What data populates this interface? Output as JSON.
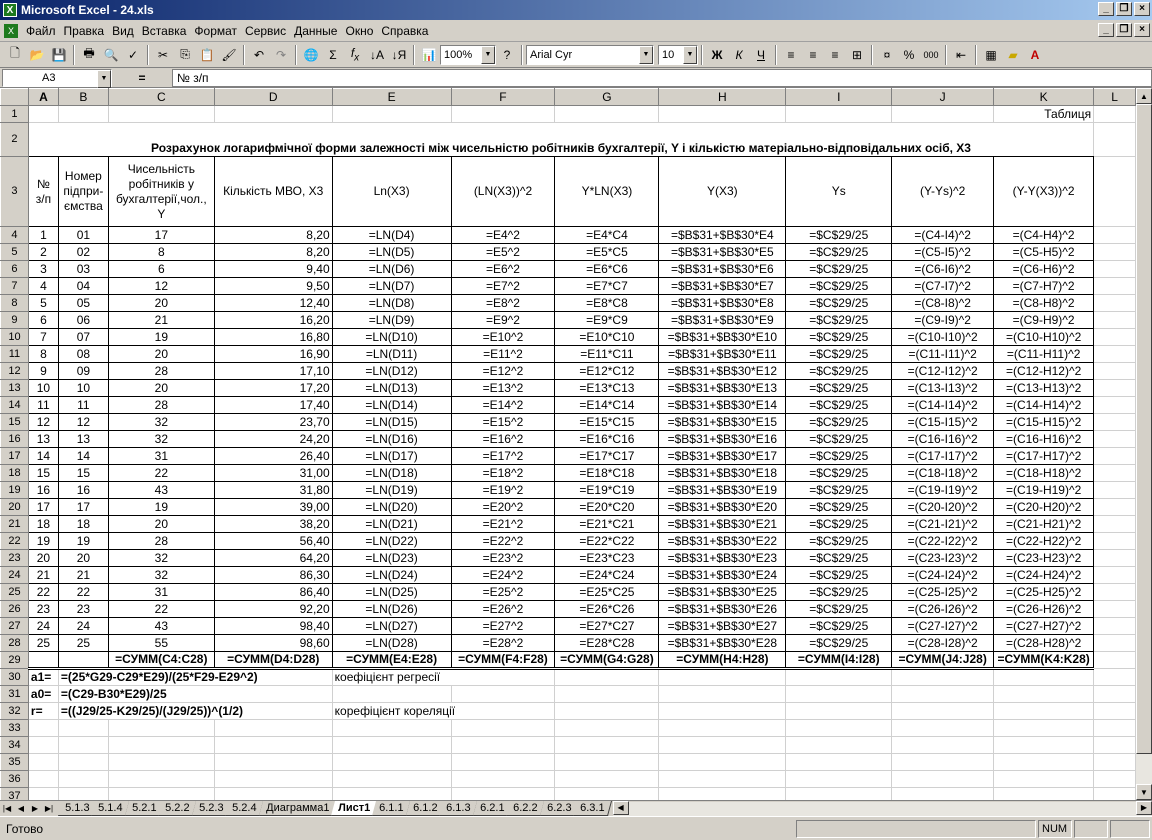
{
  "window": {
    "title": "Microsoft Excel - 24.xls"
  },
  "menu": [
    "Файл",
    "Правка",
    "Вид",
    "Вставка",
    "Формат",
    "Сервис",
    "Данные",
    "Окно",
    "Справка"
  ],
  "toolbar": {
    "zoom": "100%",
    "font": "Arial Cyr",
    "size": "10",
    "bold": "Ж",
    "italic": "К",
    "underline": "Ч"
  },
  "formula_bar": {
    "name_box": "A3",
    "eq": "=",
    "content": "№ з/п"
  },
  "columns": [
    "A",
    "B",
    "C",
    "D",
    "E",
    "F",
    "G",
    "H",
    "I",
    "J",
    "K",
    "L"
  ],
  "sheet": {
    "r1_k": "Таблиця",
    "r2_title": "Розрахунок логарифмічної форми залежності між чисельністю робітників бухгалтерії, Y і кількістю матеріально-відповідальних осіб, X3",
    "headers": [
      "№ з/п",
      "Номер підпри-ємства",
      "Чисельність робітників у бухгалтерії,чол., Y",
      "Кількість МВО, Х3",
      "Ln(X3)",
      "(LN(X3))^2",
      "Y*LN(X3)",
      "Y(X3)",
      "Ys",
      "(Y-Ys)^2",
      "(Y-Y(X3))^2"
    ],
    "rows": [
      [
        "1",
        "01",
        "17",
        "8,20",
        "=LN(D4)",
        "=E4^2",
        "=E4*C4",
        "=$B$31+$B$30*E4",
        "=$C$29/25",
        "=(C4-I4)^2",
        "=(C4-H4)^2"
      ],
      [
        "2",
        "02",
        "8",
        "8,20",
        "=LN(D5)",
        "=E5^2",
        "=E5*C5",
        "=$B$31+$B$30*E5",
        "=$C$29/25",
        "=(C5-I5)^2",
        "=(C5-H5)^2"
      ],
      [
        "3",
        "03",
        "6",
        "9,40",
        "=LN(D6)",
        "=E6^2",
        "=E6*C6",
        "=$B$31+$B$30*E6",
        "=$C$29/25",
        "=(C6-I6)^2",
        "=(C6-H6)^2"
      ],
      [
        "4",
        "04",
        "12",
        "9,50",
        "=LN(D7)",
        "=E7^2",
        "=E7*C7",
        "=$B$31+$B$30*E7",
        "=$C$29/25",
        "=(C7-I7)^2",
        "=(C7-H7)^2"
      ],
      [
        "5",
        "05",
        "20",
        "12,40",
        "=LN(D8)",
        "=E8^2",
        "=E8*C8",
        "=$B$31+$B$30*E8",
        "=$C$29/25",
        "=(C8-I8)^2",
        "=(C8-H8)^2"
      ],
      [
        "6",
        "06",
        "21",
        "16,20",
        "=LN(D9)",
        "=E9^2",
        "=E9*C9",
        "=$B$31+$B$30*E9",
        "=$C$29/25",
        "=(C9-I9)^2",
        "=(C9-H9)^2"
      ],
      [
        "7",
        "07",
        "19",
        "16,80",
        "=LN(D10)",
        "=E10^2",
        "=E10*C10",
        "=$B$31+$B$30*E10",
        "=$C$29/25",
        "=(C10-I10)^2",
        "=(C10-H10)^2"
      ],
      [
        "8",
        "08",
        "20",
        "16,90",
        "=LN(D11)",
        "=E11^2",
        "=E11*C11",
        "=$B$31+$B$30*E11",
        "=$C$29/25",
        "=(C11-I11)^2",
        "=(C11-H11)^2"
      ],
      [
        "9",
        "09",
        "28",
        "17,10",
        "=LN(D12)",
        "=E12^2",
        "=E12*C12",
        "=$B$31+$B$30*E12",
        "=$C$29/25",
        "=(C12-I12)^2",
        "=(C12-H12)^2"
      ],
      [
        "10",
        "10",
        "20",
        "17,20",
        "=LN(D13)",
        "=E13^2",
        "=E13*C13",
        "=$B$31+$B$30*E13",
        "=$C$29/25",
        "=(C13-I13)^2",
        "=(C13-H13)^2"
      ],
      [
        "11",
        "11",
        "28",
        "17,40",
        "=LN(D14)",
        "=E14^2",
        "=E14*C14",
        "=$B$31+$B$30*E14",
        "=$C$29/25",
        "=(C14-I14)^2",
        "=(C14-H14)^2"
      ],
      [
        "12",
        "12",
        "32",
        "23,70",
        "=LN(D15)",
        "=E15^2",
        "=E15*C15",
        "=$B$31+$B$30*E15",
        "=$C$29/25",
        "=(C15-I15)^2",
        "=(C15-H15)^2"
      ],
      [
        "13",
        "13",
        "32",
        "24,20",
        "=LN(D16)",
        "=E16^2",
        "=E16*C16",
        "=$B$31+$B$30*E16",
        "=$C$29/25",
        "=(C16-I16)^2",
        "=(C16-H16)^2"
      ],
      [
        "14",
        "14",
        "31",
        "26,40",
        "=LN(D17)",
        "=E17^2",
        "=E17*C17",
        "=$B$31+$B$30*E17",
        "=$C$29/25",
        "=(C17-I17)^2",
        "=(C17-H17)^2"
      ],
      [
        "15",
        "15",
        "22",
        "31,00",
        "=LN(D18)",
        "=E18^2",
        "=E18*C18",
        "=$B$31+$B$30*E18",
        "=$C$29/25",
        "=(C18-I18)^2",
        "=(C18-H18)^2"
      ],
      [
        "16",
        "16",
        "43",
        "31,80",
        "=LN(D19)",
        "=E19^2",
        "=E19*C19",
        "=$B$31+$B$30*E19",
        "=$C$29/25",
        "=(C19-I19)^2",
        "=(C19-H19)^2"
      ],
      [
        "17",
        "17",
        "19",
        "39,00",
        "=LN(D20)",
        "=E20^2",
        "=E20*C20",
        "=$B$31+$B$30*E20",
        "=$C$29/25",
        "=(C20-I20)^2",
        "=(C20-H20)^2"
      ],
      [
        "18",
        "18",
        "20",
        "38,20",
        "=LN(D21)",
        "=E21^2",
        "=E21*C21",
        "=$B$31+$B$30*E21",
        "=$C$29/25",
        "=(C21-I21)^2",
        "=(C21-H21)^2"
      ],
      [
        "19",
        "19",
        "28",
        "56,40",
        "=LN(D22)",
        "=E22^2",
        "=E22*C22",
        "=$B$31+$B$30*E22",
        "=$C$29/25",
        "=(C22-I22)^2",
        "=(C22-H22)^2"
      ],
      [
        "20",
        "20",
        "32",
        "64,20",
        "=LN(D23)",
        "=E23^2",
        "=E23*C23",
        "=$B$31+$B$30*E23",
        "=$C$29/25",
        "=(C23-I23)^2",
        "=(C23-H23)^2"
      ],
      [
        "21",
        "21",
        "32",
        "86,30",
        "=LN(D24)",
        "=E24^2",
        "=E24*C24",
        "=$B$31+$B$30*E24",
        "=$C$29/25",
        "=(C24-I24)^2",
        "=(C24-H24)^2"
      ],
      [
        "22",
        "22",
        "31",
        "86,40",
        "=LN(D25)",
        "=E25^2",
        "=E25*C25",
        "=$B$31+$B$30*E25",
        "=$C$29/25",
        "=(C25-I25)^2",
        "=(C25-H25)^2"
      ],
      [
        "23",
        "23",
        "22",
        "92,20",
        "=LN(D26)",
        "=E26^2",
        "=E26*C26",
        "=$B$31+$B$30*E26",
        "=$C$29/25",
        "=(C26-I26)^2",
        "=(C26-H26)^2"
      ],
      [
        "24",
        "24",
        "43",
        "98,40",
        "=LN(D27)",
        "=E27^2",
        "=E27*C27",
        "=$B$31+$B$30*E27",
        "=$C$29/25",
        "=(C27-I27)^2",
        "=(C27-H27)^2"
      ],
      [
        "25",
        "25",
        "55",
        "98,60",
        "=LN(D28)",
        "=E28^2",
        "=E28*C28",
        "=$B$31+$B$30*E28",
        "=$C$29/25",
        "=(C28-I28)^2",
        "=(C28-H28)^2"
      ]
    ],
    "sums": [
      "=СУММ(C4:C28)",
      "=СУММ(D4:D28)",
      "=СУММ(E4:E28)",
      "=СУММ(F4:F28)",
      "=СУММ(G4:G28)",
      "=СУММ(H4:H28)",
      "=СУММ(I4:I28)",
      "=СУММ(J4:J28)",
      "=СУММ(K4:K28)"
    ],
    "r30": {
      "a": "a1=",
      "b": "=(25*G29-C29*E29)/(25*F29-E29^2)",
      "e": "коефіцієнт регресії"
    },
    "r31": {
      "a": "a0=",
      "b": "=(C29-B30*E29)/25"
    },
    "r32": {
      "a": "r=",
      "b": "=((J29/25-K29/25)/(J29/25))^(1/2)",
      "e": "корефіцієнт кореляції"
    }
  },
  "tabs": [
    "5.1.3",
    "5.1.4",
    "5.2.1",
    "5.2.2",
    "5.2.3",
    "5.2.4",
    "Диаграмма1",
    "Лист1",
    "6.1.1",
    "6.1.2",
    "6.1.3",
    "6.2.1",
    "6.2.2",
    "6.2.3",
    "6.3.1"
  ],
  "active_tab": "Лист1",
  "status": {
    "text": "Готово",
    "num": "NUM"
  }
}
